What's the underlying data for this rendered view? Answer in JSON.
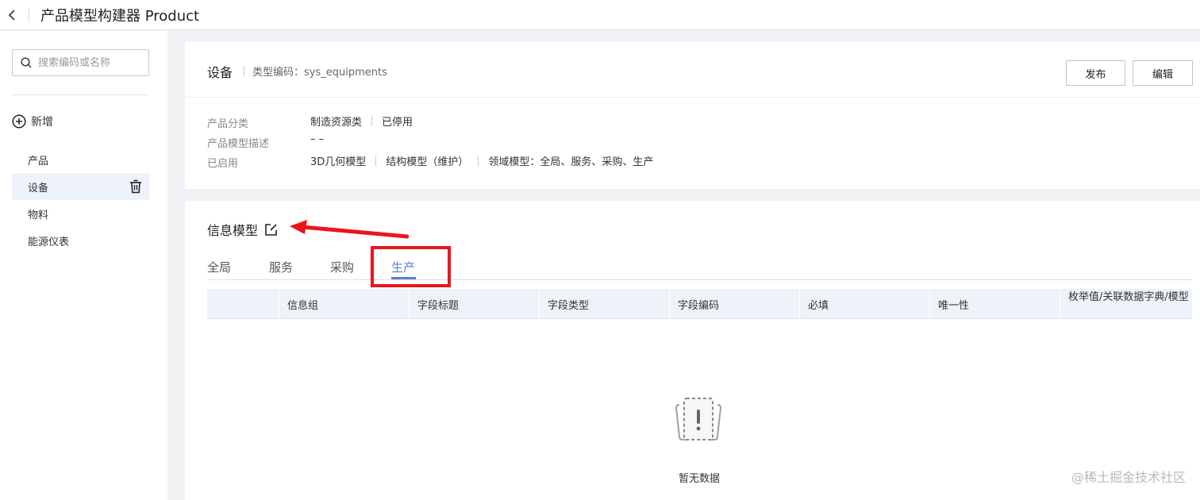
{
  "header": {
    "title": "产品模型构建器 Product"
  },
  "sidebar": {
    "search_placeholder": "搜索编码或名称",
    "add_label": "新增",
    "items": [
      {
        "label": "产品"
      },
      {
        "label": "设备"
      },
      {
        "label": "物料"
      },
      {
        "label": "能源仪表"
      }
    ]
  },
  "detail": {
    "name": "设备",
    "type_code": "类型编码：sys_equipments",
    "publish_label": "发布",
    "edit_label": "编辑",
    "rows": [
      {
        "label": "产品分类",
        "values": [
          "制造资源类",
          "已停用"
        ]
      },
      {
        "label": "产品模型描述",
        "values": [
          "– –"
        ]
      },
      {
        "label": "已启用",
        "values": [
          "3D几何模型",
          "结构模型（维护）",
          "领域模型：全局、服务、采购、生产"
        ]
      }
    ]
  },
  "info_model": {
    "title": "信息模型",
    "tabs": [
      {
        "label": "全局"
      },
      {
        "label": "服务"
      },
      {
        "label": "采购"
      },
      {
        "label": "生产"
      }
    ],
    "active_tab": "生产",
    "columns": [
      "信息组",
      "字段标题",
      "字段类型",
      "字段编码",
      "必填",
      "唯一性",
      "枚举值/关联数据字典/模型"
    ],
    "empty_text": "暂无数据"
  },
  "watermark": "@稀土掘金技术社区",
  "colors": {
    "accent": "#5b7bd5",
    "annotation": "#e8161a"
  }
}
